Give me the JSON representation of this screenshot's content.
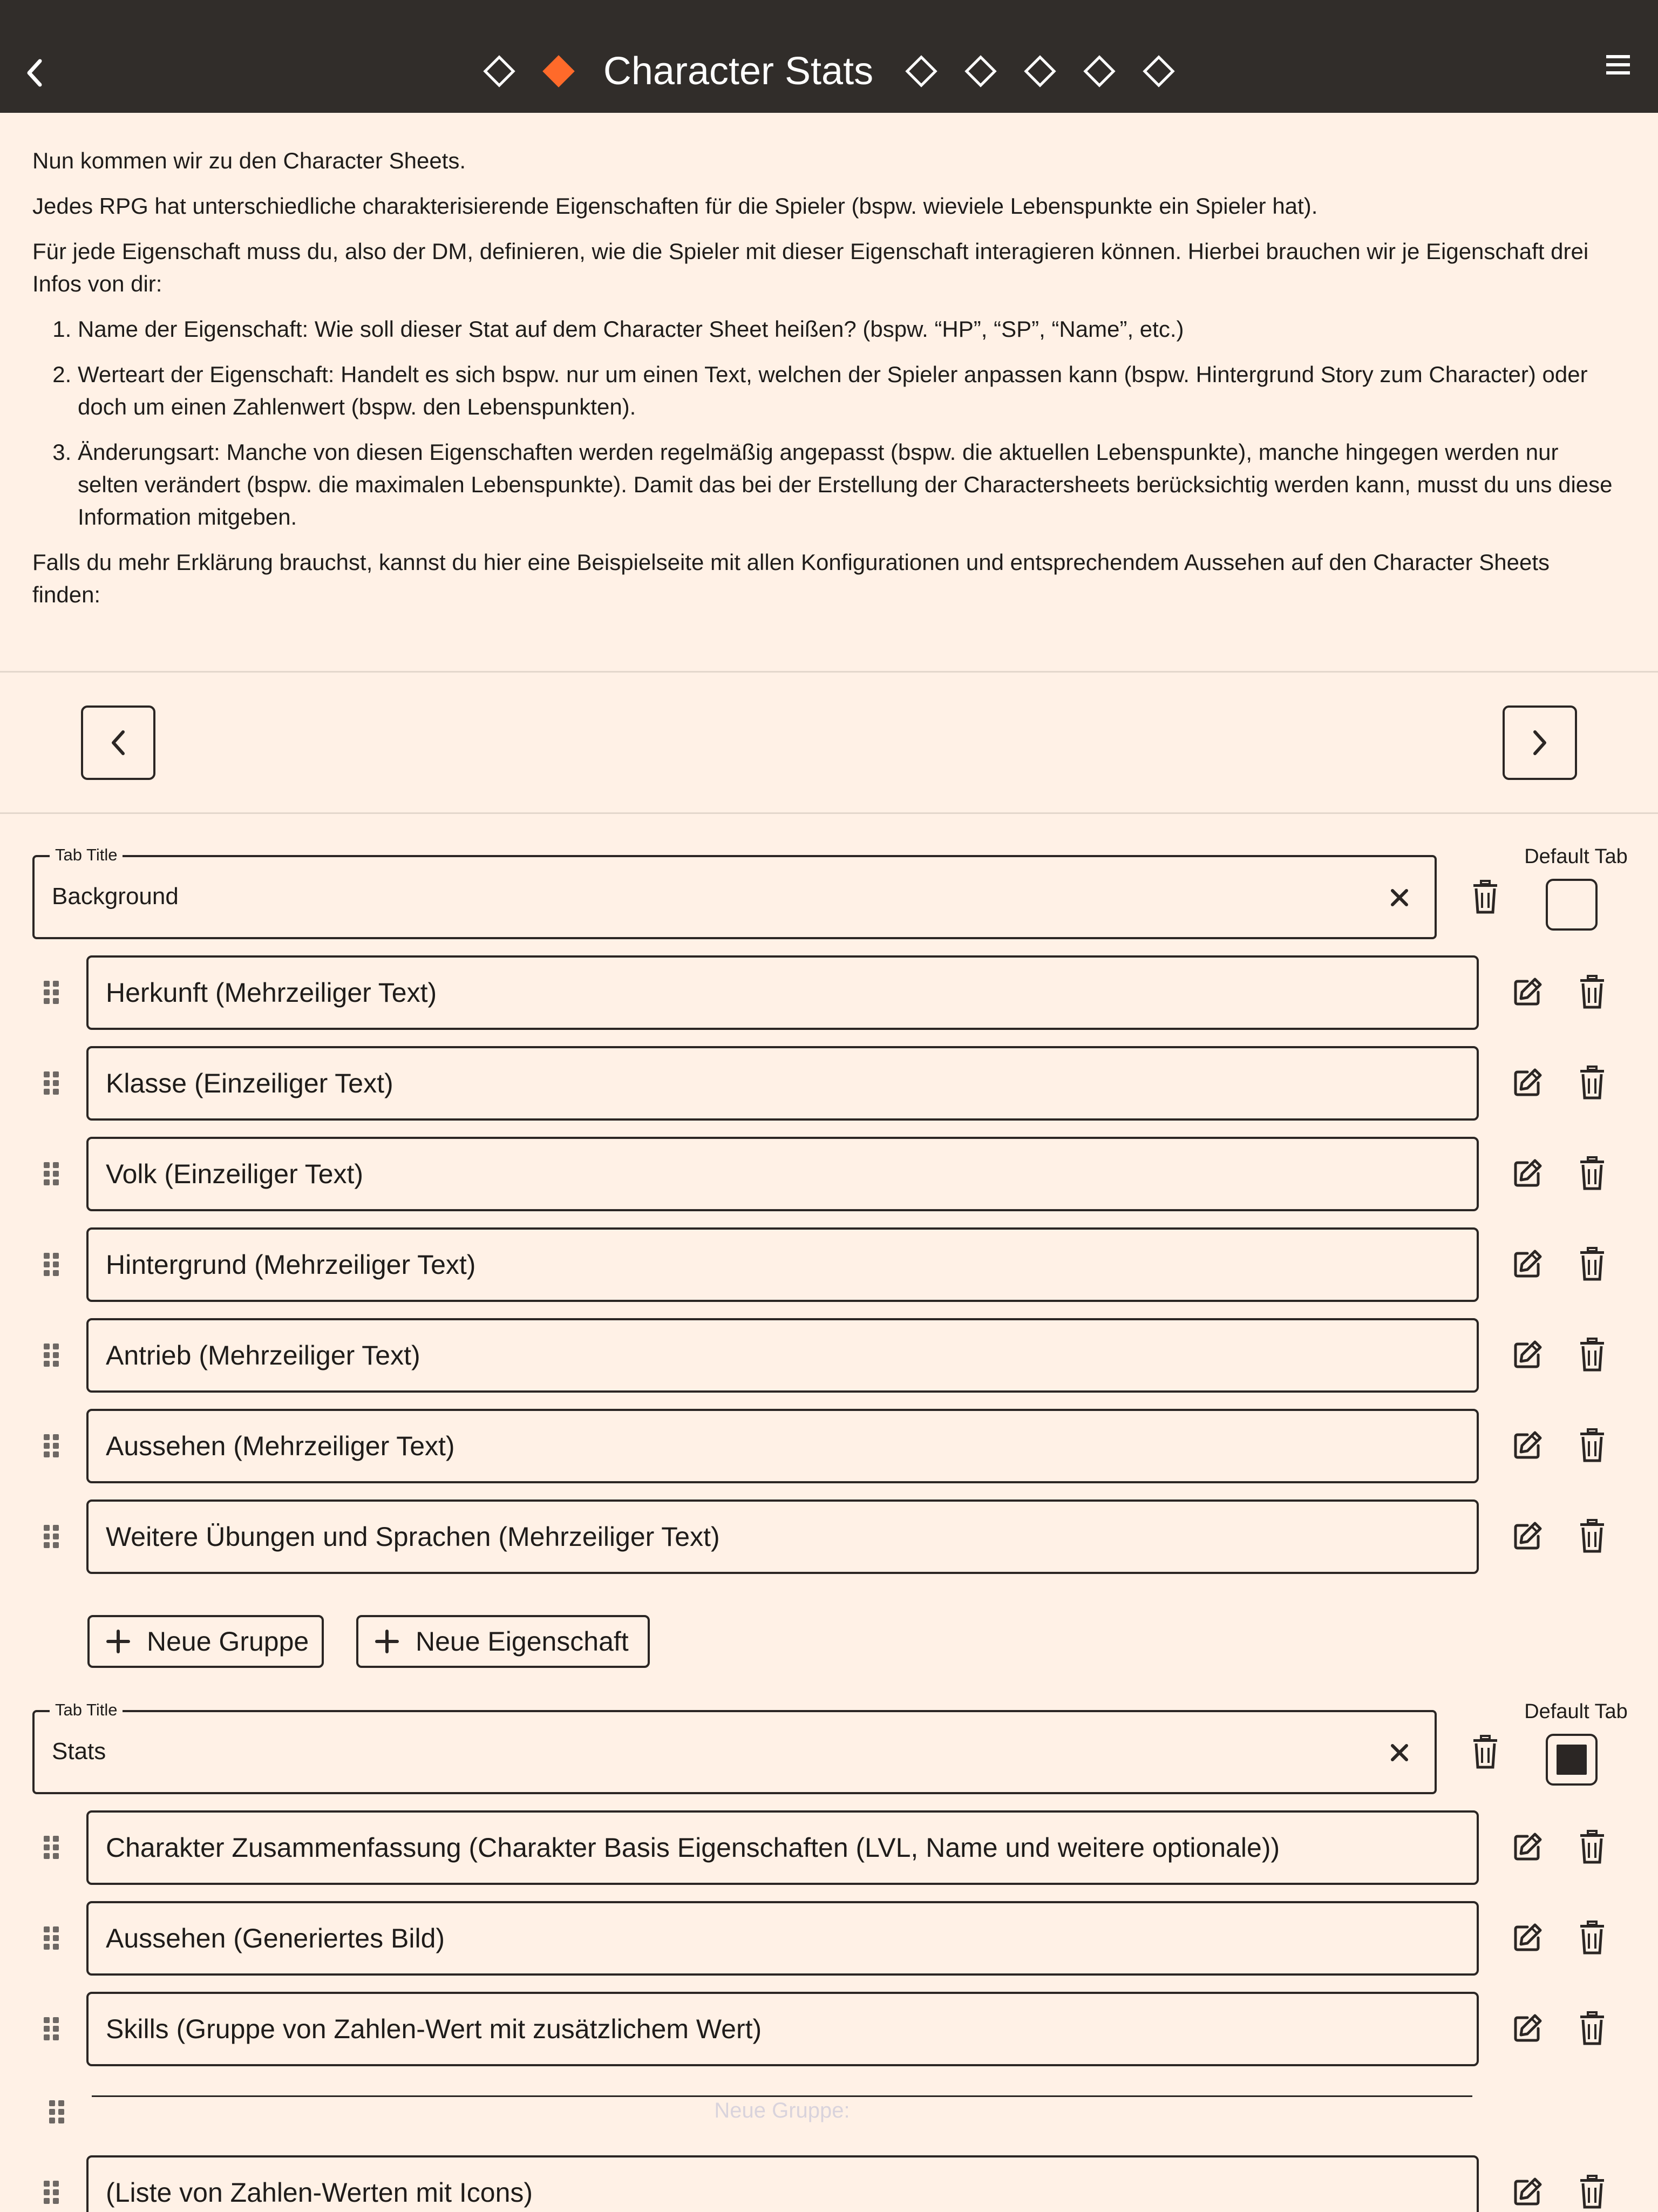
{
  "header": {
    "title": "Character Stats",
    "steps_before": 1,
    "steps_after": 5,
    "accent_color": "#ff6a2a",
    "background_color": "#312d2a"
  },
  "intro": {
    "p1": "Nun kommen wir zu den Character Sheets.",
    "p2": "Jedes RPG hat unterschiedliche charakterisierende Eigenschaften für die Spieler (bspw. wieviele Lebenspunkte ein Spieler hat).",
    "p3": "Für jede Eigenschaft muss du, also der DM, definieren, wie die Spieler mit dieser Eigenschaft interagieren können. Hierbei brauchen wir je Eigenschaft drei Infos von dir:",
    "list": [
      "Name der Eigenschaft: Wie soll dieser Stat auf dem Character Sheet heißen? (bspw. “HP”, “SP”, “Name”, etc.)",
      "Werteart der Eigenschaft: Handelt es sich bspw. nur um einen Text, welchen der Spieler anpassen kann (bspw. Hintergrund Story zum Character) oder doch um einen Zahlenwert (bspw. den Lebenspunkten).",
      "Änderungsart: Manche von diesen Eigenschaften werden regelmäßig angepasst (bspw. die aktuellen Lebenspunkte), manche hingegen werden nur selten verändert (bspw. die maximalen Lebenspunkte). Damit das bei der Erstellung der Charactersheets berücksichtig werden kann, musst du uns diese Information mitgeben."
    ],
    "p4": "Falls du mehr Erklärung brauchst, kannst du hier eine Beispielseite mit allen Konfigurationen und entsprechendem Aussehen auf den Character Sheets finden:"
  },
  "tabs": [
    {
      "legend": "Tab Title",
      "value": "Background",
      "default_label": "Default Tab",
      "is_default": false,
      "properties": [
        "Herkunft (Mehrzeiliger Text)",
        "Klasse (Einzeiliger Text)",
        "Volk (Einzeiliger Text)",
        "Hintergrund (Mehrzeiliger Text)",
        "Antrieb (Mehrzeiliger Text)",
        "Aussehen (Mehrzeiliger Text)",
        "Weitere Übungen und Sprachen (Mehrzeiliger Text)"
      ]
    },
    {
      "legend": "Tab Title",
      "value": "Stats",
      "default_label": "Default Tab",
      "is_default": true,
      "properties": [
        "Charakter Zusammenfassung (Charakter Basis Eigenschaften (LVL, Name und weitere optionale))",
        "Aussehen (Generiertes Bild)",
        "Skills (Gruppe von Zahlen-Wert mit zusätzlichem Wert)",
        "(Liste von Zahlen-Werten mit Icons)"
      ],
      "group_placeholder": "Neue Gruppe:"
    }
  ],
  "actions": {
    "new_group": "Neue Gruppe",
    "new_property": "Neue Eigenschaft"
  },
  "icons": {
    "back": "chevron-left-icon",
    "menu": "hamburger-menu-icon",
    "prev": "chevron-left-icon",
    "next": "chevron-right-icon",
    "clear": "close-icon",
    "delete": "trash-icon",
    "edit": "edit-icon",
    "drag": "drag-handle-icon",
    "add": "plus-icon"
  }
}
